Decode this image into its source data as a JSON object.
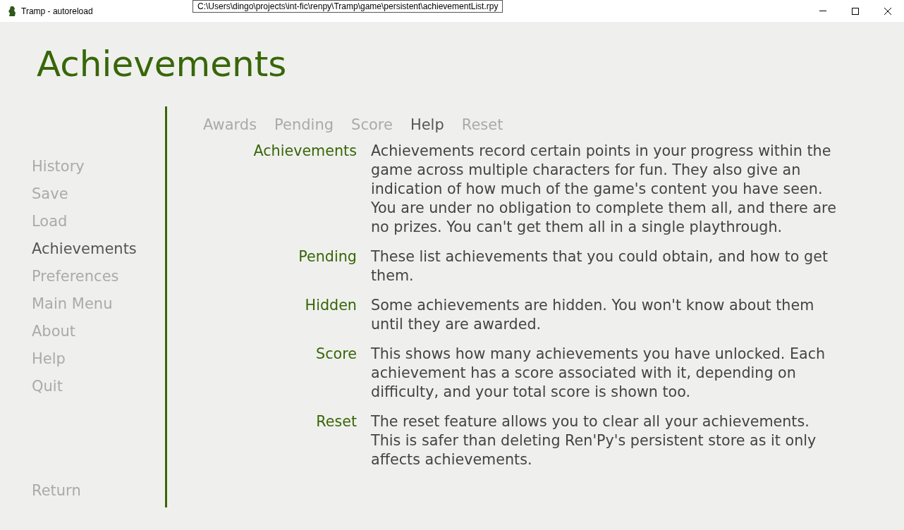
{
  "window": {
    "title": "Tramp - autoreload",
    "tooltip": "C:\\Users\\dingo\\projects\\int-fic\\renpy\\Tramp\\game\\persistent\\achievementList.rpy"
  },
  "heading": "Achievements",
  "sidebar": {
    "items": [
      {
        "label": "History",
        "selected": false
      },
      {
        "label": "Save",
        "selected": false
      },
      {
        "label": "Load",
        "selected": false
      },
      {
        "label": "Achievements",
        "selected": true
      },
      {
        "label": "Preferences",
        "selected": false
      },
      {
        "label": "Main Menu",
        "selected": false
      },
      {
        "label": "About",
        "selected": false
      },
      {
        "label": "Help",
        "selected": false
      },
      {
        "label": "Quit",
        "selected": false
      }
    ],
    "return": "Return"
  },
  "tabs": [
    {
      "label": "Awards",
      "selected": false
    },
    {
      "label": "Pending",
      "selected": false
    },
    {
      "label": "Score",
      "selected": false
    },
    {
      "label": "Help",
      "selected": true
    },
    {
      "label": "Reset",
      "selected": false
    }
  ],
  "help": [
    {
      "term": "Achievements",
      "paragraphs": [
        "Achievements record certain points in your progress within the game across multiple characters for fun. They also give an indication of how much of the game's content you have seen.",
        "You are under no obligation to complete them all, and there are no prizes. You can't get them all in a single playthrough."
      ]
    },
    {
      "term": "Pending",
      "paragraphs": [
        "These list achievements that you could obtain, and how to get them."
      ]
    },
    {
      "term": "Hidden",
      "paragraphs": [
        "Some achievements are hidden. You won't know about them until they are awarded."
      ]
    },
    {
      "term": "Score",
      "paragraphs": [
        "This shows how many achievements you have unlocked. Each achievement has a score associated with it, depending on difficulty, and your total score is shown too."
      ]
    },
    {
      "term": "Reset",
      "paragraphs": [
        "The reset feature allows you to clear all your achievements. This is safer than deleting Ren'Py's persistent store as it only affects achievements."
      ]
    }
  ]
}
